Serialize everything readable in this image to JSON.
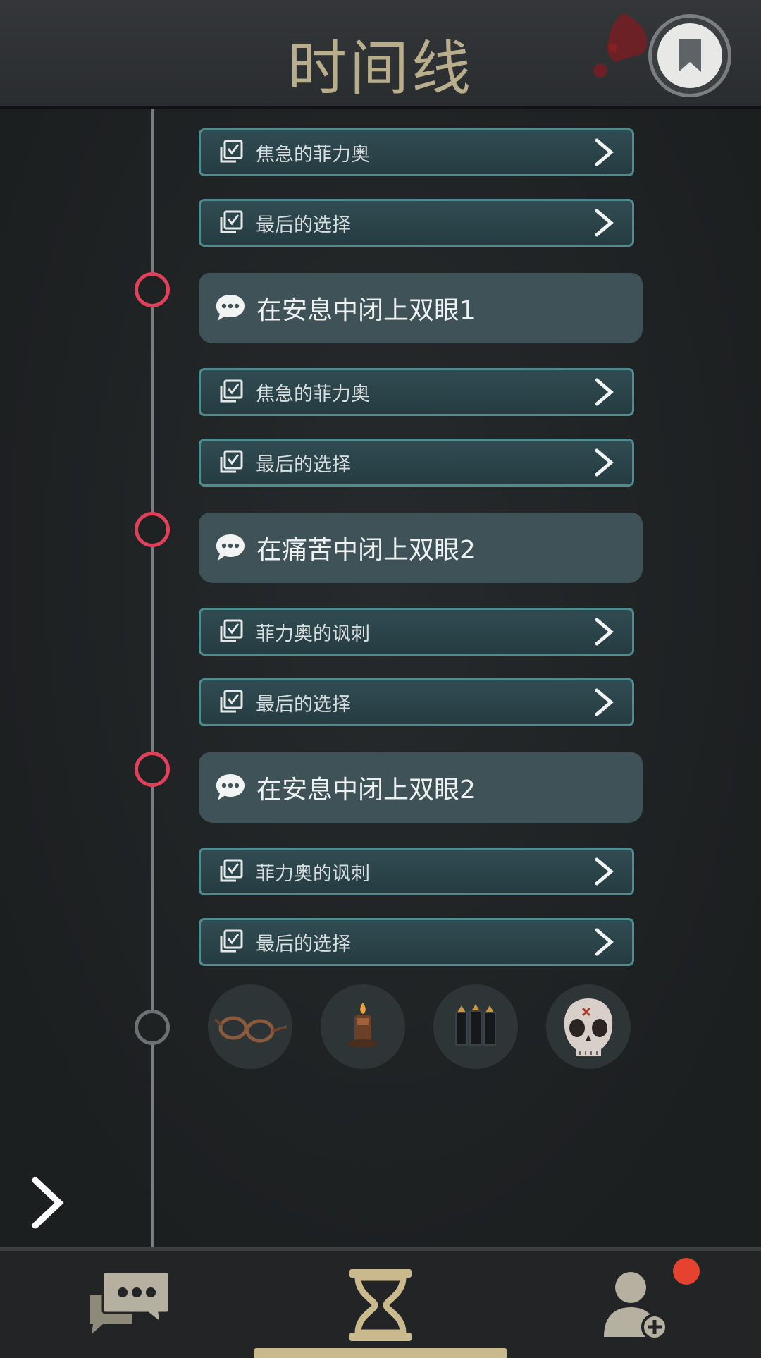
{
  "header": {
    "title": "时间线",
    "bookmark_icon": "bookmark-icon"
  },
  "timeline": [
    {
      "type": "choice",
      "label": "焦急的菲力奥"
    },
    {
      "type": "choice",
      "label": "最后的选择"
    },
    {
      "type": "event",
      "label": "在安息中闭上双眼1"
    },
    {
      "type": "choice",
      "label": "焦急的菲力奥"
    },
    {
      "type": "choice",
      "label": "最后的选择"
    },
    {
      "type": "event",
      "label": "在痛苦中闭上双眼2"
    },
    {
      "type": "choice",
      "label": "菲力奥的讽刺"
    },
    {
      "type": "choice",
      "label": "最后的选择"
    },
    {
      "type": "event",
      "label": "在安息中闭上双眼2"
    },
    {
      "type": "choice",
      "label": "菲力奥的讽刺"
    },
    {
      "type": "choice",
      "label": "最后的选择"
    }
  ],
  "items": [
    "glasses-icon",
    "candle-icon",
    "bullets-icon",
    "skull-mask-icon"
  ],
  "bottom_nav": {
    "tabs": [
      "chat-icon",
      "hourglass-icon",
      "add-contact-icon"
    ],
    "active_tab": "hourglass-icon",
    "notification_badge": true
  },
  "colors": {
    "accent": "#c9b98c",
    "node_red": "#e0405a",
    "choice_border": "#4f8c8f",
    "badge_red": "#e5432f"
  }
}
